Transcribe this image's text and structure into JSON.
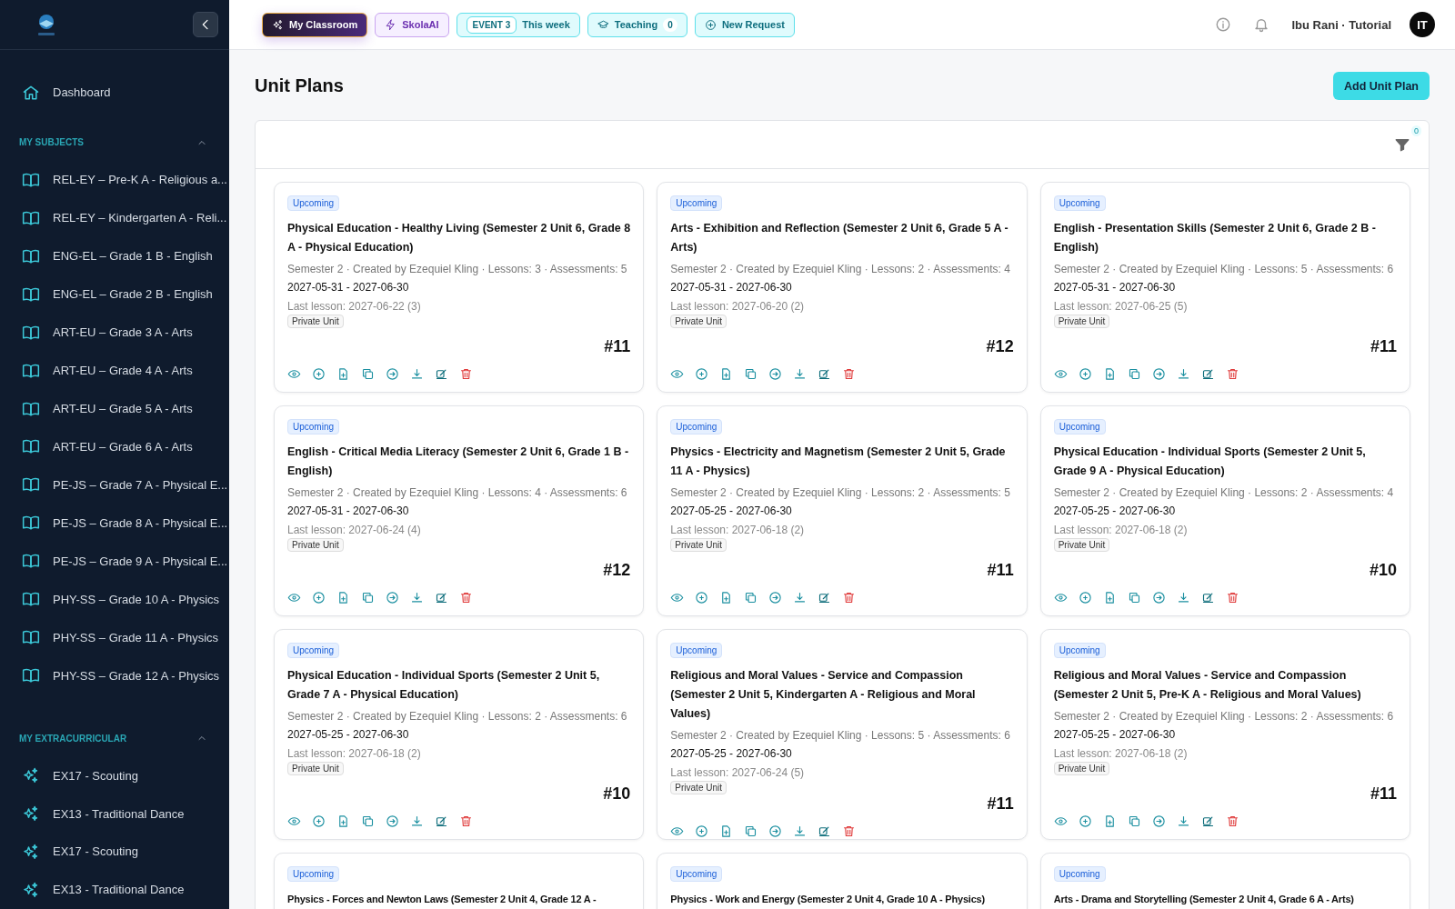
{
  "sidebar": {
    "dashboard": "Dashboard",
    "sections": [
      {
        "title": "MY SUBJECTS",
        "expanded": true,
        "kind": "subject",
        "items": [
          "REL-EY – Pre-K A - Religious a...",
          "REL-EY – Kindergarten A - Reli...",
          "ENG-EL – Grade 1 B - English",
          "ENG-EL – Grade 2 B - English",
          "ART-EU – Grade 3 A - Arts",
          "ART-EU – Grade 4 A - Arts",
          "ART-EU – Grade 5 A - Arts",
          "ART-EU – Grade 6 A - Arts",
          "PE-JS – Grade 7 A - Physical E...",
          "PE-JS – Grade 8 A - Physical E...",
          "PE-JS – Grade 9 A - Physical E...",
          "PHY-SS – Grade 10 A - Physics",
          "PHY-SS – Grade 11 A - Physics",
          "PHY-SS – Grade 12 A - Physics"
        ]
      },
      {
        "title": "MY EXTRACURRICULAR",
        "expanded": true,
        "kind": "extracurricular",
        "items": [
          "EX17 - Scouting",
          "EX13 - Traditional Dance",
          "EX17 - Scouting",
          "EX13 - Traditional Dance"
        ]
      }
    ]
  },
  "topbar": {
    "chips": [
      {
        "kind": "classroom",
        "label": "My Classroom",
        "selected": true
      },
      {
        "kind": "ai",
        "label": "SkolaAI",
        "selected": false
      },
      {
        "kind": "event",
        "badge": "EVENT 3",
        "label": "This week",
        "selected": false
      },
      {
        "kind": "teaching",
        "label": "Teaching",
        "count": "0",
        "selected": false
      },
      {
        "kind": "request",
        "label": "New Request",
        "selected": false
      }
    ],
    "user": "Ibu Rani · Tutorial",
    "avatar": "IT"
  },
  "page": {
    "title": "Unit Plans",
    "add_button": "Add Unit Plan",
    "filter_count": "0"
  },
  "cards": [
    {
      "status": "Upcoming",
      "title": "Physical Education - Healthy Living (Semester 2 Unit 6, Grade 8 A - Physical Education)",
      "meta": "Semester 2 · Created by Ezequiel Kling · Lessons: 3 · Assessments: 5",
      "dates": "2027-05-31 - 2027-06-30",
      "last_lesson": "Last lesson: 2027-06-22 (3)",
      "tag": "Private Unit",
      "number": "#11"
    },
    {
      "status": "Upcoming",
      "title": "Arts - Exhibition and Reflection (Semester 2 Unit 6, Grade 5 A - Arts)",
      "meta": "Semester 2 · Created by Ezequiel Kling · Lessons: 2 · Assessments: 4",
      "dates": "2027-05-31 - 2027-06-30",
      "last_lesson": "Last lesson: 2027-06-20 (2)",
      "tag": "Private Unit",
      "number": "#12"
    },
    {
      "status": "Upcoming",
      "title": "English - Presentation Skills (Semester 2 Unit 6, Grade 2 B - English)",
      "meta": "Semester 2 · Created by Ezequiel Kling · Lessons: 5 · Assessments: 6",
      "dates": "2027-05-31 - 2027-06-30",
      "last_lesson": "Last lesson: 2027-06-25 (5)",
      "tag": "Private Unit",
      "number": "#11"
    },
    {
      "status": "Upcoming",
      "title": "English - Critical Media Literacy (Semester 2 Unit 6, Grade 1 B - English)",
      "meta": "Semester 2 · Created by Ezequiel Kling · Lessons: 4 · Assessments: 6",
      "dates": "2027-05-31 - 2027-06-30",
      "last_lesson": "Last lesson: 2027-06-24 (4)",
      "tag": "Private Unit",
      "number": "#12"
    },
    {
      "status": "Upcoming",
      "title": "Physics - Electricity and Magnetism (Semester 2 Unit 5, Grade 11 A - Physics)",
      "meta": "Semester 2 · Created by Ezequiel Kling · Lessons: 2 · Assessments: 5",
      "dates": "2027-05-25 - 2027-06-30",
      "last_lesson": "Last lesson: 2027-06-18 (2)",
      "tag": "Private Unit",
      "number": "#11"
    },
    {
      "status": "Upcoming",
      "title": "Physical Education - Individual Sports (Semester 2 Unit 5, Grade 9 A - Physical Education)",
      "meta": "Semester 2 · Created by Ezequiel Kling · Lessons: 2 · Assessments: 4",
      "dates": "2027-05-25 - 2027-06-30",
      "last_lesson": "Last lesson: 2027-06-18 (2)",
      "tag": "Private Unit",
      "number": "#10"
    },
    {
      "status": "Upcoming",
      "title": "Physical Education - Individual Sports (Semester 2 Unit 5, Grade 7 A - Physical Education)",
      "meta": "Semester 2 · Created by Ezequiel Kling · Lessons: 2 · Assessments: 6",
      "dates": "2027-05-25 - 2027-06-30",
      "last_lesson": "Last lesson: 2027-06-18 (2)",
      "tag": "Private Unit",
      "number": "#10"
    },
    {
      "status": "Upcoming",
      "title": "Religious and Moral Values - Service and Compassion (Semester 2 Unit 5, Kindergarten A - Religious and Moral Values)",
      "meta": "Semester 2 · Created by Ezequiel Kling · Lessons: 5 · Assessments: 6",
      "dates": "2027-05-25 - 2027-06-30",
      "last_lesson": "Last lesson: 2027-06-24 (5)",
      "tag": "Private Unit",
      "number": "#11"
    },
    {
      "status": "Upcoming",
      "title": "Religious and Moral Values - Service and Compassion (Semester 2 Unit 5, Pre-K A - Religious and Moral Values)",
      "meta": "Semester 2 · Created by Ezequiel Kling · Lessons: 2 · Assessments: 6",
      "dates": "2027-05-25 - 2027-06-30",
      "last_lesson": "Last lesson: 2027-06-18 (2)",
      "tag": "Private Unit",
      "number": "#11"
    },
    {
      "status": "Upcoming",
      "title": "Physics - Forces and Newton Laws (Semester 2 Unit 4, Grade 12 A -"
    },
    {
      "status": "Upcoming",
      "title": "Physics - Work and Energy (Semester 2 Unit 4, Grade 10 A - Physics)"
    },
    {
      "status": "Upcoming",
      "title": "Arts - Drama and Storytelling (Semester 2 Unit 4, Grade 6 A - Arts)"
    }
  ]
}
